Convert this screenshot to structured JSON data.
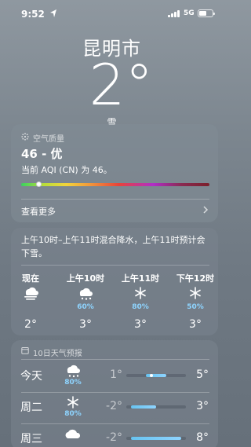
{
  "status_bar": {
    "time": "9:52",
    "network": "5G",
    "battery_level": 0.5
  },
  "header": {
    "city": "昆明市",
    "temperature": "2°",
    "condition": "雪"
  },
  "aqi_card": {
    "caption": "空气质量",
    "value": "46 - 优",
    "description": "当前 AQI (CN) 为 46。",
    "index": 46,
    "scale_max": 500,
    "more_label": "查看更多"
  },
  "hourly_card": {
    "summary": "上午10时–上午11时混合降水，上午11时预计会下雪。",
    "hours": [
      {
        "label": "现在",
        "icon": "fog-icon",
        "precip": "",
        "temp": "2°"
      },
      {
        "label": "上午10时",
        "icon": "sleet-icon",
        "precip": "60%",
        "temp": "3°"
      },
      {
        "label": "上午11时",
        "icon": "snowflake-icon",
        "precip": "80%",
        "temp": "3°"
      },
      {
        "label": "下午12时",
        "icon": "snowflake-icon",
        "precip": "50%",
        "temp": "3°"
      }
    ]
  },
  "daily_card": {
    "caption": "10日天气预报",
    "range_min": -3,
    "range_max": 9,
    "days": [
      {
        "name": "今天",
        "icon": "sleet-icon",
        "precip": "80%",
        "low": "1°",
        "high": "5°",
        "low_value": 1,
        "high_value": 5,
        "current": 2
      },
      {
        "name": "周二",
        "icon": "snowflake-icon",
        "precip": "80%",
        "low": "-2°",
        "high": "3°",
        "low_value": -2,
        "high_value": 3
      },
      {
        "name": "周三",
        "icon": "cloud-icon",
        "precip": "",
        "low": "-2°",
        "high": "8°",
        "low_value": -2,
        "high_value": 8
      }
    ]
  },
  "colors": {
    "precip_blue": "#8ed4ff",
    "background": "#7c868f"
  }
}
